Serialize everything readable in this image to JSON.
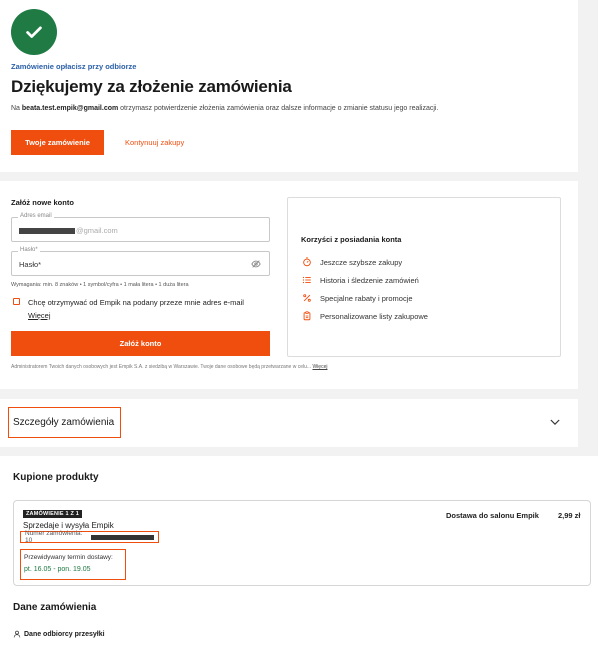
{
  "confirmation": {
    "pickup_note": "Zamówienie opłacisz przy odbiorze",
    "title": "Dziękujemy za złożenie zamówienia",
    "message_prefix": "Na ",
    "email": "beata.test.empik@gmail.com",
    "message_suffix": " otrzymasz potwierdzenie złożenia zamówienia oraz dalsze informacje o zmianie statusu jego realizacji.",
    "order_button": "Twoje zamówienie",
    "continue_link": "Kontynuuj zakupy"
  },
  "register": {
    "title": "Załóż nowe konto",
    "email_label": "Adres email",
    "email_value_suffix": "@gmail.com",
    "password_label": "Hasło*",
    "password_value": "Hasło*",
    "requirements": "Wymagania: min. 8 znaków • 1 symbol/cyfra • 1 mała litera • 1 duża litera",
    "consent_text": "Chcę otrzymywać od Empik na podany przeze mnie adres e-mail",
    "more_link": "Więcej",
    "create_button": "Załóż konto",
    "admin_text": "Administratorem Twoich danych osobowych jest Empik S.A. z siedzibą w Warszawie. Twoje dane osobowe będą przetwarzane w celu...",
    "admin_more": "Więcej"
  },
  "benefits": {
    "title": "Korzyści z posiadania konta",
    "items": [
      {
        "icon": "stopwatch-icon",
        "label": "Jeszcze szybsze zakupy"
      },
      {
        "icon": "list-icon",
        "label": "Historia i śledzenie zamówień"
      },
      {
        "icon": "percent-icon",
        "label": "Specjalne rabaty i promocje"
      },
      {
        "icon": "clipboard-list-icon",
        "label": "Personalizowane listy zakupowe"
      }
    ]
  },
  "order_details": {
    "label": "Szczegóły zamówienia"
  },
  "products": {
    "title": "Kupione produkty",
    "badge": "ZAMÓWIENIE 1 Z 1",
    "seller": "Sprzedaje i wysyła Empik",
    "order_number_label": "Numer zamówienia: 10",
    "delivery_label": "Przewidywany termin dostawy:",
    "delivery_dates": "pt. 16.05 - pon. 19.05",
    "delivery_type": "Dostawa do salonu Empik",
    "price": "2,99 zł"
  },
  "order_data": {
    "title": "Dane zamówienia",
    "recipient": "Dane odbiorcy przesyłki"
  },
  "colors": {
    "accent": "#f04e0f",
    "success": "#1f7a43",
    "link": "#2a5fa8"
  }
}
